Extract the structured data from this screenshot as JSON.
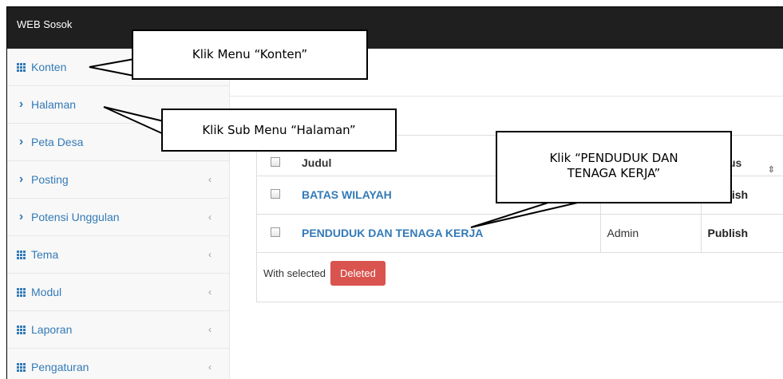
{
  "app": {
    "brand": "WEB Sosok"
  },
  "sidebar": {
    "items": [
      {
        "label": "Konten",
        "icon": "grid-icon"
      },
      {
        "label": "Halaman",
        "icon": "chevron-right-icon"
      },
      {
        "label": "Peta Desa",
        "icon": "chevron-right-icon"
      },
      {
        "label": "Posting",
        "icon": "chevron-right-icon",
        "caret": "‹"
      },
      {
        "label": "Potensi Unggulan",
        "icon": "chevron-right-icon",
        "caret": "‹"
      },
      {
        "label": "Tema",
        "icon": "grid-icon",
        "caret": "‹"
      },
      {
        "label": "Modul",
        "icon": "grid-icon",
        "caret": "‹"
      },
      {
        "label": "Laporan",
        "icon": "grid-icon",
        "caret": "‹"
      },
      {
        "label": "Pengaturan",
        "icon": "grid-icon",
        "caret": "‹"
      }
    ]
  },
  "table": {
    "headers": {
      "judul": "Judul",
      "status": "Status"
    },
    "rows": [
      {
        "judul": "BATAS WILAYAH",
        "author": "",
        "status": "Publish"
      },
      {
        "judul": "PENDUDUK DAN TENAGA KERJA",
        "author": "Admin",
        "status": "Publish"
      }
    ],
    "with_selected": "With selected",
    "delete_button": "Deleted"
  },
  "callouts": {
    "konten": "Klik Menu “Konten”",
    "halaman": "Klik Sub Menu “Halaman”",
    "penduduk_line1": "Klik “PENDUDUK DAN",
    "penduduk_line2": "TENAGA KERJA”"
  },
  "colors": {
    "topbar": "#1f1f1f",
    "link": "#337ab7",
    "danger": "#d9534f",
    "sidebar_bg": "#f8f8f8"
  }
}
